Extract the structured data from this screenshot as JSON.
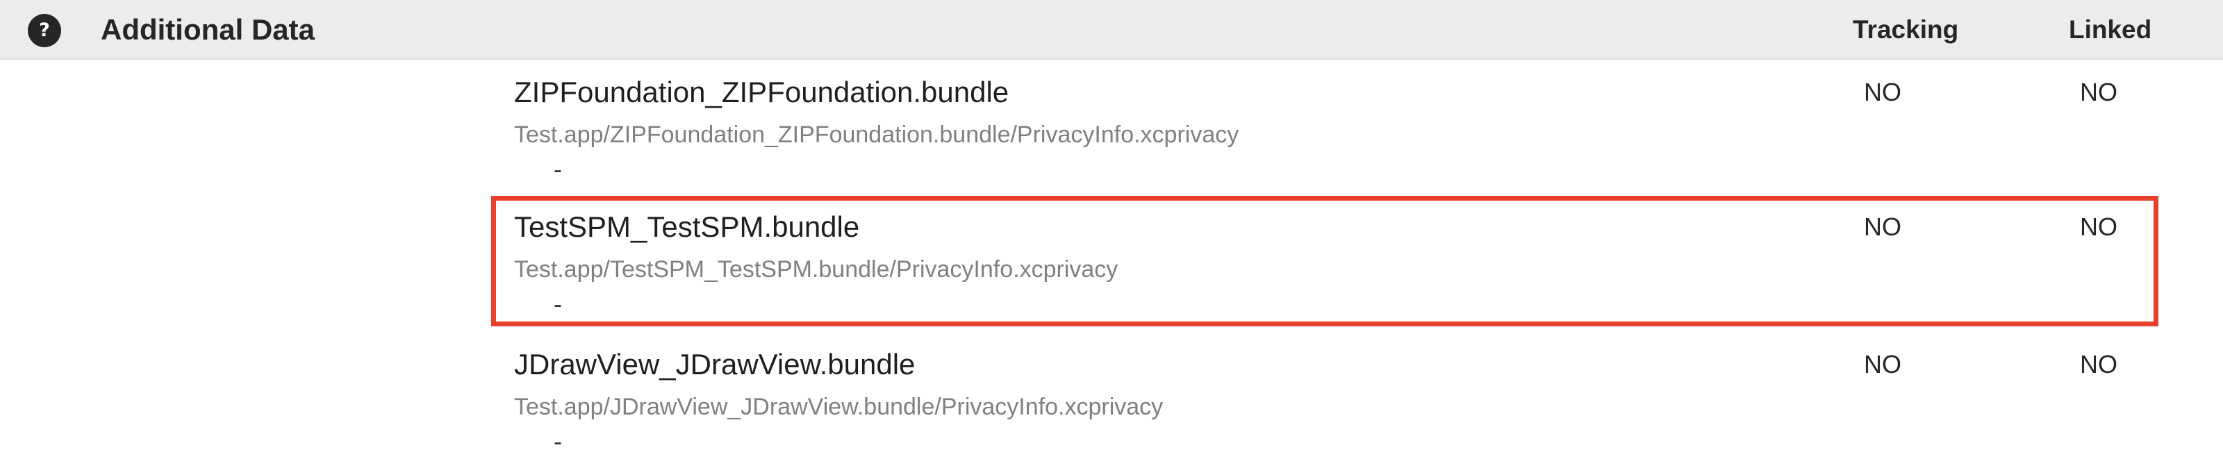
{
  "header": {
    "help_icon": "question-mark-icon",
    "help_glyph": "?",
    "title": "Additional Data",
    "columns": {
      "tracking": "Tracking",
      "linked": "Linked"
    }
  },
  "rows": [
    {
      "name": "ZIPFoundation_ZIPFoundation.bundle",
      "path": "Test.app/ZIPFoundation_ZIPFoundation.bundle/PrivacyInfo.xcprivacy",
      "detail": "-",
      "tracking": "NO",
      "linked": "NO"
    },
    {
      "name": "TestSPM_TestSPM.bundle",
      "path": "Test.app/TestSPM_TestSPM.bundle/PrivacyInfo.xcprivacy",
      "detail": "-",
      "tracking": "NO",
      "linked": "NO",
      "highlighted": true
    },
    {
      "name": "JDrawView_JDrawView.bundle",
      "path": "Test.app/JDrawView_JDrawView.bundle/PrivacyInfo.xcprivacy",
      "detail": "-",
      "tracking": "NO",
      "linked": "NO"
    }
  ],
  "colors": {
    "header_bg": "#ececec",
    "highlight_border": "#e8402a",
    "path_text": "#808080"
  }
}
